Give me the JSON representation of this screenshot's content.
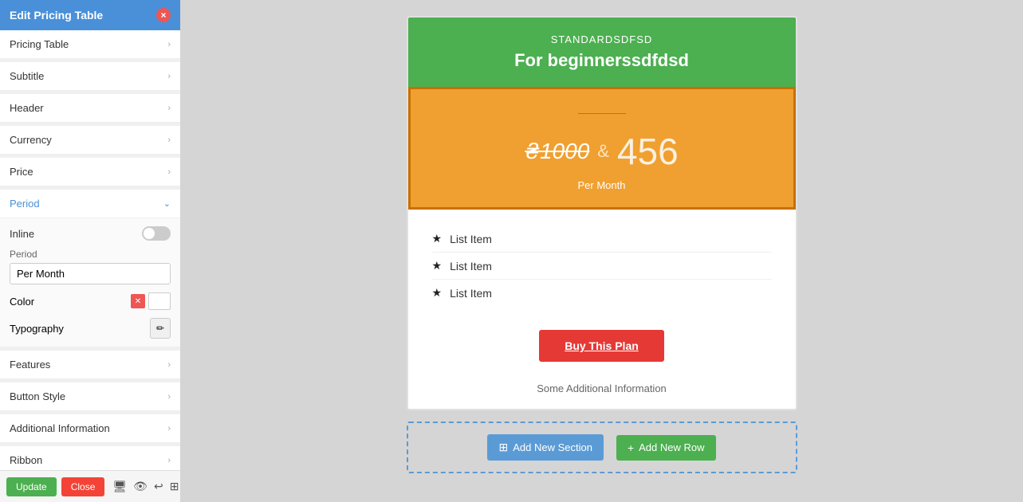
{
  "panel": {
    "title": "Edit Pricing Table",
    "close_label": "×",
    "items": [
      {
        "id": "pricing-table",
        "label": "Pricing Table",
        "expanded": false
      },
      {
        "id": "subtitle",
        "label": "Subtitle",
        "expanded": false
      },
      {
        "id": "header",
        "label": "Header",
        "expanded": false
      },
      {
        "id": "currency",
        "label": "Currency",
        "expanded": false
      },
      {
        "id": "price",
        "label": "Price",
        "expanded": false
      },
      {
        "id": "period",
        "label": "Period",
        "expanded": true
      },
      {
        "id": "features",
        "label": "Features",
        "expanded": false
      },
      {
        "id": "button-style",
        "label": "Button Style",
        "expanded": false
      },
      {
        "id": "additional-info",
        "label": "Additional Information",
        "expanded": false
      },
      {
        "id": "ribbon",
        "label": "Ribbon",
        "expanded": false
      }
    ],
    "period_section": {
      "inline_label": "Inline",
      "period_label": "Period",
      "period_value": "Per Month",
      "color_label": "Color",
      "typography_label": "Typography"
    },
    "footer": {
      "update_label": "Update",
      "close_label": "Close"
    }
  },
  "pricing_card": {
    "plan_name": "STANDARDSDFSD",
    "plan_subtitle": "For beginnerssdfdsd",
    "old_price": "₴1000",
    "ampersand": "&",
    "new_price": "456",
    "period": "Per Month",
    "features": [
      {
        "label": "List Item"
      },
      {
        "label": "List Item"
      },
      {
        "label": "List Item"
      }
    ],
    "buy_button_label": "Buy This Plan",
    "additional_info": "Some Additional Information"
  },
  "bottom_bar": {
    "add_section_label": "Add New Section",
    "add_row_label": "Add New Row"
  },
  "colors": {
    "header_bg": "#4caf50",
    "price_bg": "#f0a030",
    "buy_btn_bg": "#e53935",
    "add_btn_bg": "#5b9bd5",
    "add_row_btn_bg": "#4caf50"
  }
}
